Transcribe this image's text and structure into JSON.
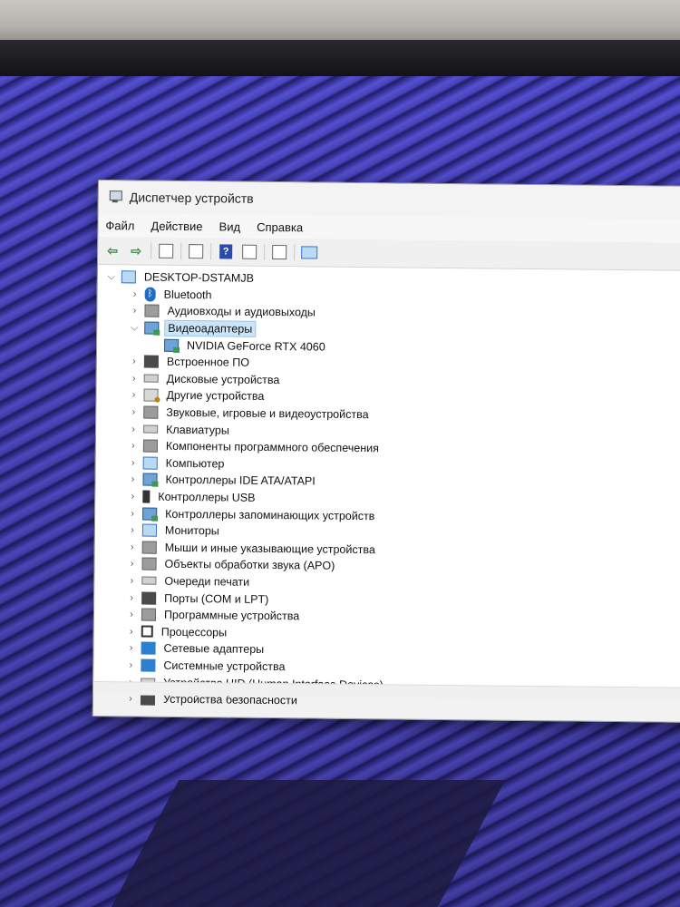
{
  "window": {
    "title": "Диспетчер устройств"
  },
  "menu": {
    "file": "Файл",
    "action": "Действие",
    "view": "Вид",
    "help": "Справка"
  },
  "tree": {
    "root": "DESKTOP-DSTAMJB",
    "bluetooth": "Bluetooth",
    "audio_io": "Аудиовходы и аудиовыходы",
    "video_adapters": "Видеоадаптеры",
    "gpu": "NVIDIA GeForce RTX 4060",
    "firmware": "Встроенное ПО",
    "disk_devices": "Дисковые устройства",
    "other_devices": "Другие устройства",
    "sound_devices": "Звуковые, игровые и видеоустройства",
    "keyboards": "Клавиатуры",
    "software_components": "Компоненты программного обеспечения",
    "computer": "Компьютер",
    "ide_controllers": "Контроллеры IDE ATA/ATAPI",
    "usb_controllers": "Контроллеры USB",
    "storage_controllers": "Контроллеры запоминающих устройств",
    "monitors": "Мониторы",
    "mice": "Мыши и иные указывающие устройства",
    "apo": "Объекты обработки звука (APO)",
    "print_queues": "Очереди печати",
    "ports": "Порты (COM и LPT)",
    "software_devices": "Программные устройства",
    "processors": "Процессоры",
    "network_adapters": "Сетевые адаптеры",
    "system_devices": "Системные устройства",
    "hid": "Устройства HID (Human Interface Devices)",
    "security_devices": "Устройства безопасности"
  }
}
